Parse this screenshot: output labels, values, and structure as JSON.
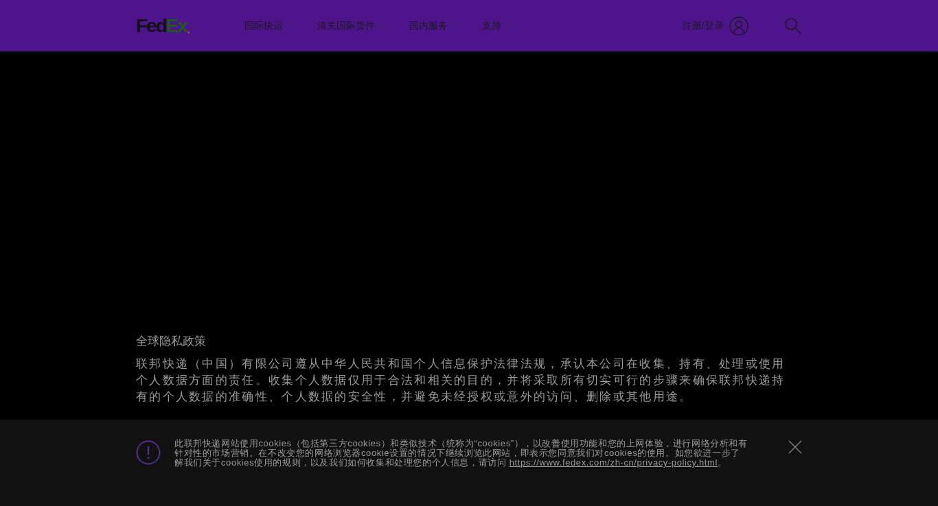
{
  "header": {
    "logo": {
      "part_1": "Fed",
      "part_2": "Ex",
      "dot": "."
    },
    "nav": [
      {
        "label": "国际快运"
      },
      {
        "label": "清关国际货件"
      },
      {
        "label": "国内服务"
      },
      {
        "label": "支持"
      }
    ],
    "account": {
      "label": "注册/登录"
    }
  },
  "content": {
    "title": "全球隐私政策",
    "paragraph": "联邦快递（中国）有限公司遵从中华人民共和国个人信息保护法律法规，承认本公司在收集、持有、处理或使用个人数据方面的责任。收集个人数据仅用于合法和相关的目的，并将采取所有切实可行的步骤来确保联邦快递持有的个人数据的准确性、个人数据的安全性，并避免未经授权或意外的访问、删除或其他用途。"
  },
  "cookie_banner": {
    "text": "此联邦快递网站使用cookies（包括第三方cookies）和类似技术（统称为“cookies”），以改善使用功能和您的上网体验，进行网络分析和有针对性的市场营销。在不改变您的网络浏览器cookie设置的情况下继续浏览此网站，即表示您同意我们对cookies的使用。如您欲进一步了解我们关于cookies使用的规则，以及我们如何收集和处理您的个人信息，请访问 ",
    "link": "https://www.fedex.com/zh-cn/privacy-policy.html",
    "end": "。"
  }
}
